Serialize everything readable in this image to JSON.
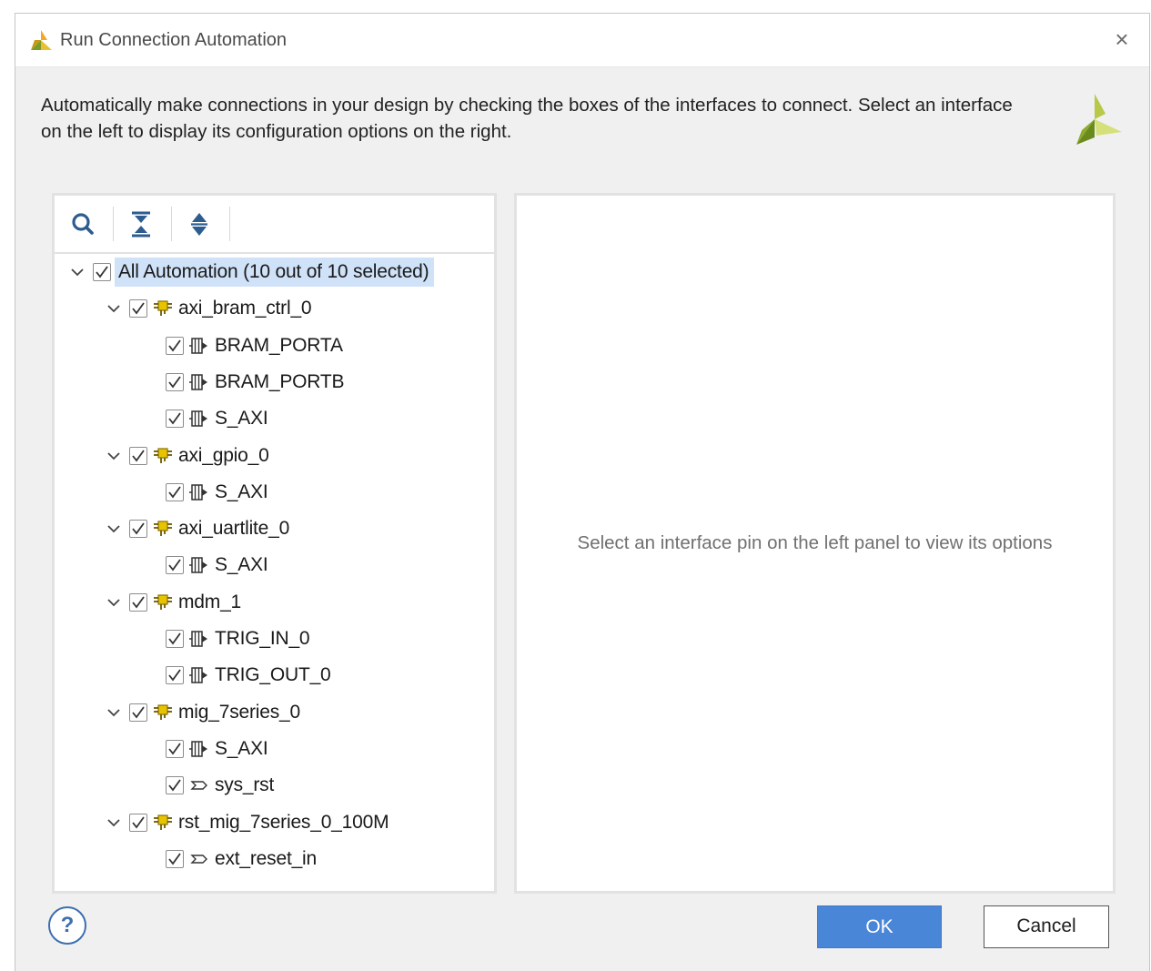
{
  "window": {
    "title": "Run Connection Automation",
    "close_glyph": "×"
  },
  "description": "Automatically make connections in your design by checking the boxes of the interfaces to connect. Select an interface on the left to display its configuration options on the right.",
  "toolbar": {
    "icons": [
      "search-icon",
      "collapse-all-icon",
      "expand-all-icon"
    ]
  },
  "tree": {
    "root": {
      "label": "All Automation (10 out of 10 selected)",
      "checked": true,
      "expanded": true
    },
    "items": [
      {
        "label": "axi_bram_ctrl_0",
        "type": "ip",
        "level": 1,
        "checked": true,
        "expanded": true
      },
      {
        "label": "BRAM_PORTA",
        "type": "interface",
        "level": 2,
        "checked": true
      },
      {
        "label": "BRAM_PORTB",
        "type": "interface",
        "level": 2,
        "checked": true
      },
      {
        "label": "S_AXI",
        "type": "interface",
        "level": 2,
        "checked": true
      },
      {
        "label": "axi_gpio_0",
        "type": "ip",
        "level": 1,
        "checked": true,
        "expanded": true
      },
      {
        "label": "S_AXI",
        "type": "interface",
        "level": 2,
        "checked": true
      },
      {
        "label": "axi_uartlite_0",
        "type": "ip",
        "level": 1,
        "checked": true,
        "expanded": true
      },
      {
        "label": "S_AXI",
        "type": "interface",
        "level": 2,
        "checked": true
      },
      {
        "label": "mdm_1",
        "type": "ip",
        "level": 1,
        "checked": true,
        "expanded": true
      },
      {
        "label": "TRIG_IN_0",
        "type": "interface",
        "level": 2,
        "checked": true
      },
      {
        "label": "TRIG_OUT_0",
        "type": "interface",
        "level": 2,
        "checked": true
      },
      {
        "label": "mig_7series_0",
        "type": "ip",
        "level": 1,
        "checked": true,
        "expanded": true
      },
      {
        "label": "S_AXI",
        "type": "interface",
        "level": 2,
        "checked": true
      },
      {
        "label": "sys_rst",
        "type": "pin",
        "level": 2,
        "checked": true
      },
      {
        "label": "rst_mig_7series_0_100M",
        "type": "ip",
        "level": 1,
        "checked": true,
        "expanded": true
      },
      {
        "label": "ext_reset_in",
        "type": "pin",
        "level": 2,
        "checked": true
      }
    ]
  },
  "right_panel": {
    "hint": "Select an interface pin on the left panel to view its options"
  },
  "footer": {
    "help_glyph": "?",
    "ok_label": "OK",
    "cancel_label": "Cancel"
  },
  "colors": {
    "accent": "#4a86d8",
    "selection": "#cfe2f8",
    "ip_icon": "#e0c000",
    "brand": "#8cab2c"
  }
}
